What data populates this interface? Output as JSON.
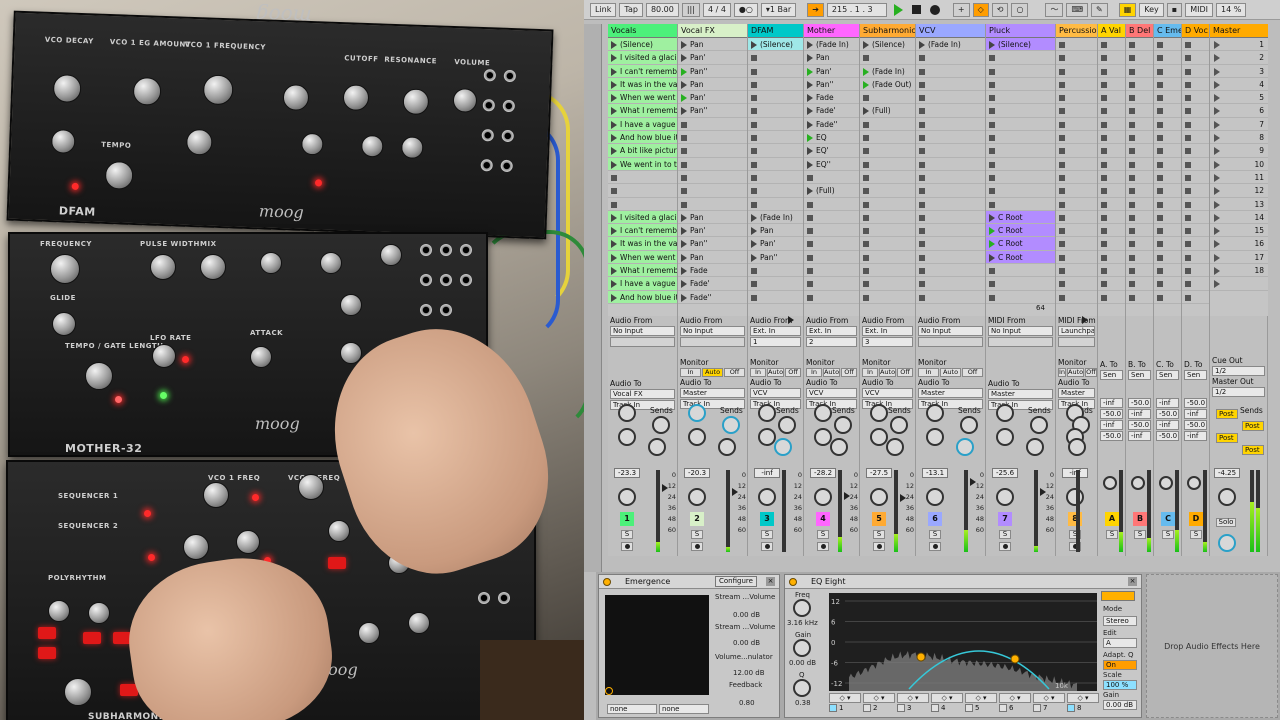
{
  "hardware": {
    "brand": "moog",
    "modules": [
      "DFAM",
      "MOTHER-32",
      "SUBHARMONICON"
    ],
    "panel_labels": [
      "VCO DECAY",
      "VCO 1 EG AMOUNT",
      "VCO 1 FREQUENCY",
      "CUTOFF",
      "RESONANCE",
      "VOLUME",
      "TEMPO",
      "FREQUENCY",
      "PULSE WIDTH",
      "MIX",
      "GLIDE",
      "TEMPO / GATE LENGTH",
      "LFO RATE",
      "ATTACK",
      "VCO 1 FREQ",
      "VCO 2 FREQ",
      "SEQUENCER 1",
      "SEQUENCER 2",
      "POLYRHYTHM"
    ]
  },
  "transport": {
    "link": "Link",
    "tap": "Tap",
    "tempo": "80.00",
    "signature_num": "4",
    "signature_den": "4",
    "quantize": "1 Bar",
    "position": "215 . 1 . 3",
    "key": "Key",
    "midi": "MIDI",
    "cpu": "14 %"
  },
  "tracks": [
    {
      "name": "Vocals",
      "color": "#4cf07a"
    },
    {
      "name": "Vocal FX",
      "color": "#d8f0c8"
    },
    {
      "name": "DFAM",
      "color": "#00c8c8"
    },
    {
      "name": "Mother",
      "color": "#ff66ff"
    },
    {
      "name": "Subharmonic",
      "color": "#ffaa33"
    },
    {
      "name": "VCV",
      "color": "#9aa8ff"
    },
    {
      "name": "Pluck",
      "color": "#b28cff"
    },
    {
      "name": "Percussion",
      "color": "#ffbb44"
    },
    {
      "name": "A Val",
      "color": "#ffd400"
    },
    {
      "name": "B Del",
      "color": "#ff7777"
    },
    {
      "name": "C Eme",
      "color": "#66bbee"
    },
    {
      "name": "D Voc",
      "color": "#ffaa00"
    }
  ],
  "master_name": "Master",
  "clips": {
    "vocals": [
      "(Silence)",
      "I visited a glaci",
      "I can't rememb",
      "It was in the va",
      "When we went",
      "What I rememb",
      "I have a vague",
      "And how blue it",
      "A bit like pictur",
      "We went in to t",
      "",
      "",
      "",
      "I visited a glaci",
      "I can't rememb",
      "It was in the va",
      "When we went",
      "What I rememb",
      "I have a vague",
      "And how blue it"
    ],
    "vocalfx": [
      "Pan",
      "Pan'",
      "Pan''",
      "Pan",
      "Pan'",
      "Pan''",
      "",
      "",
      "",
      "",
      "",
      "",
      "",
      "Pan",
      "Pan'",
      "Pan''",
      "Pan",
      "Fade",
      "Fade'",
      "Fade''"
    ],
    "dfam": [
      "(Silence)",
      "",
      "",
      "",
      "",
      "",
      "",
      "",
      "",
      "",
      "",
      "",
      "",
      "(Fade In)",
      "Pan",
      "Pan'",
      "Pan''",
      "",
      "",
      ""
    ],
    "mother": [
      "(Fade In)",
      "Pan",
      "Pan'",
      "Pan''",
      "Fade",
      "Fade'",
      "Fade''",
      "EQ",
      "EQ'",
      "EQ''",
      "",
      "(Full)",
      "",
      "",
      "",
      "",
      "",
      "",
      "",
      ""
    ],
    "subharmonic": [
      "(Silence)",
      "",
      "(Fade In)",
      "(Fade Out)",
      "",
      "(Full)",
      "",
      "",
      "",
      "",
      "",
      "",
      "",
      "",
      "",
      "",
      "",
      "",
      "",
      ""
    ],
    "vcv": [
      "(Fade In)",
      "",
      "",
      "",
      "",
      "",
      "",
      "",
      "",
      "",
      "",
      "",
      "",
      "",
      "",
      "",
      "",
      "",
      "",
      ""
    ],
    "pluck": [
      "(Silence)",
      "",
      "",
      "",
      "",
      "",
      "",
      "",
      "",
      "",
      "",
      "",
      "",
      "C Root",
      "C Root",
      "C Root",
      "C Root",
      "",
      "",
      ""
    ]
  },
  "scenes": [
    "1",
    "2",
    "3",
    "4",
    "5",
    "6",
    "7",
    "8",
    "9",
    "10",
    "11",
    "12",
    "13",
    "14",
    "15",
    "16",
    "17",
    "18",
    ""
  ],
  "io": {
    "audio_from": "Audio From",
    "midi_from": "MIDI From",
    "audio_to": "Audio To",
    "monitor": "Monitor",
    "in": "In",
    "auto": "Auto",
    "off": "Off",
    "no_input": "No Input",
    "ext_in": "Ext. In",
    "launchpad": "Launchpa",
    "vocal_fx": "Vocal FX",
    "master": "Master",
    "vcv": "VCV",
    "track_in": "Track In",
    "sends": "Sends",
    "cue_out": "Cue Out",
    "cue_val": "1/2",
    "master_out": "Master Out",
    "master_val": "1/2",
    "a_to": "A. To",
    "b_to": "B. To",
    "c_to": "C. To",
    "d_to": "D. To",
    "send_val": "Sen",
    "post": "Post",
    "solo": "Solo",
    "pluck_info": "64",
    "ch1": "1",
    "ch2": "2",
    "ch3": "3"
  },
  "volumes": [
    "-23.3",
    "-20.3",
    "-inf",
    "-28.2",
    "-27.5",
    "-13.1",
    "-25.6",
    "-inf",
    "",
    "",
    "",
    "",
    "-4.25"
  ],
  "return_sends": [
    "-inf",
    "-50.0",
    "-inf",
    "-50.0"
  ],
  "track_numbers": [
    "1",
    "2",
    "3",
    "4",
    "5",
    "6",
    "7",
    "8",
    "A",
    "B",
    "C",
    "D"
  ],
  "db_scale": [
    "0",
    "12",
    "24",
    "36",
    "48",
    "60"
  ],
  "emergence": {
    "title": "Emergence",
    "configure": "Configure",
    "p1_label": "Stream ...Volume",
    "p1_val": "0.00 dB",
    "p2_label": "Stream ...Volume",
    "p2_val": "0.00 dB",
    "p3_label": "Volume...nulator",
    "p3_val": "12.00 dB",
    "p4_label": "Feedback",
    "p4_val": "0.80",
    "sel1": "none",
    "sel2": "none"
  },
  "eq": {
    "title": "EQ Eight",
    "freq_label": "Freq",
    "freq_val": "3.16 kHz",
    "gain_label": "Gain",
    "gain_val": "0.00 dB",
    "q_label": "Q",
    "q_val": "0.38",
    "mode_label": "Mode",
    "mode_val": "Stereo",
    "edit_label": "Edit",
    "edit_val": "A",
    "adapt_label": "Adapt. Q",
    "adapt_val": "On",
    "scale_label": "Scale",
    "scale_val": "100 %",
    "gain2_label": "Gain",
    "gain2_val": "0.00 dB",
    "y_ticks": [
      "12",
      "6",
      "0",
      "-6",
      "-12"
    ],
    "x_tick": "10k",
    "bands": [
      "1",
      "2",
      "3",
      "4",
      "5",
      "6",
      "7",
      "8"
    ]
  },
  "drop_text": "Drop Audio Effects Here"
}
